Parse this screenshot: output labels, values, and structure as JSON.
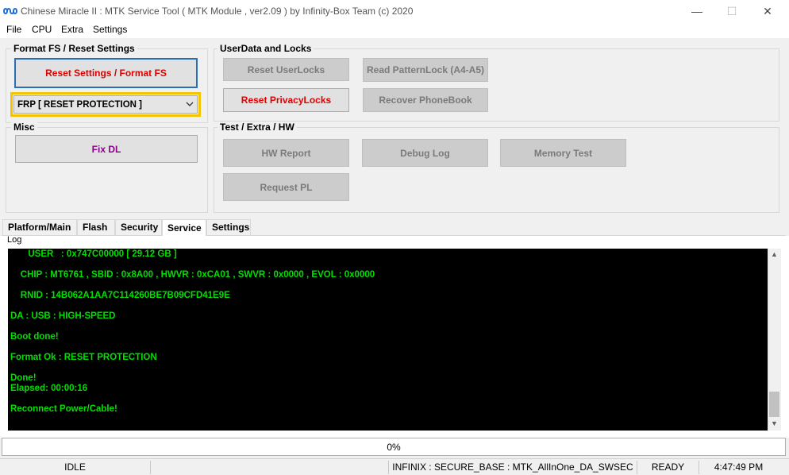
{
  "window": {
    "title": "Chinese Miracle II : MTK Service Tool ( MTK Module , ver2.09  ) by Infinity-Box Team (c) 2020",
    "minimize": "—",
    "maximize": "☐",
    "close": "✕"
  },
  "menu": [
    "File",
    "CPU",
    "Extra",
    "Settings"
  ],
  "format_group": {
    "title": "Format FS / Reset Settings",
    "reset_button": "Reset Settings / Format FS",
    "dropdown_value": "FRP [ RESET PROTECTION ]"
  },
  "misc_group": {
    "title": "Misc",
    "fix_dl": "Fix DL"
  },
  "userdata_group": {
    "title": "UserData  and Locks",
    "reset_userlocks": "Reset UserLocks",
    "read_patternlock": "Read PatternLock (A4-A5)",
    "reset_privacylocks": "Reset PrivacyLocks",
    "recover_phonebook": "Recover PhoneBook"
  },
  "test_group": {
    "title": "Test / Extra / HW",
    "hw_report": "HW Report",
    "debug_log": "Debug Log",
    "memory_test": "Memory Test",
    "request_pl": "Request PL"
  },
  "tabs": [
    "Platform/Main",
    "Flash",
    "Security",
    "Service",
    "Settings"
  ],
  "active_tab": "Service",
  "log_label": "Log",
  "log_lines": [
    "       USER   : 0x747C00000 [ 29.12 GB ]",
    "    CHIP : MT6761 , SBID : 0x8A00 , HWVR : 0xCA01 , SWVR : 0x0000 , EVOL : 0x0000",
    "    RNID : 14B062A1AA7C114260BE7B09CFD41E9E",
    "DA : USB : HIGH-SPEED",
    "Boot done!",
    "Format Ok : RESET PROTECTION",
    "Done!",
    "Elapsed: 00:00:16",
    "Reconnect Power/Cable!"
  ],
  "progress": {
    "text": "0%",
    "value": 0
  },
  "status": {
    "state": "IDLE",
    "info": "INFINIX : SECURE_BASE : MTK_AllInOne_DA_SWSEC",
    "ready": "READY",
    "time": "4:47:49 PM"
  },
  "colors": {
    "log_background": "#000000",
    "log_text": "#00e000",
    "highlight_border": "#f5c400",
    "active_button_border": "#2a6fb5",
    "red_label": "#e00000",
    "purple_label": "#8b008b"
  }
}
